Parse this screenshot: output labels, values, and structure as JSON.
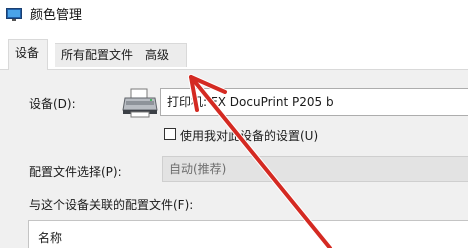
{
  "window": {
    "title": "颜色管理"
  },
  "tabs": [
    {
      "label": "设备",
      "active": true
    },
    {
      "label": "所有配置文件",
      "active": false
    },
    {
      "label": "高级",
      "active": false
    }
  ],
  "device": {
    "label": "设备(D):",
    "selected_value": "打印机: FX DocuPrint P205 b",
    "checkbox_label": "使用我对此设备的设置(U)",
    "checkbox_checked": false
  },
  "profile_selection": {
    "label": "配置文件选择(P):",
    "value": "自动(推荐)"
  },
  "associated_profiles": {
    "label": "与这个设备关联的配置文件(F):",
    "column_header": "名称"
  },
  "annotation": {
    "arrow_color": "#d42a22"
  }
}
